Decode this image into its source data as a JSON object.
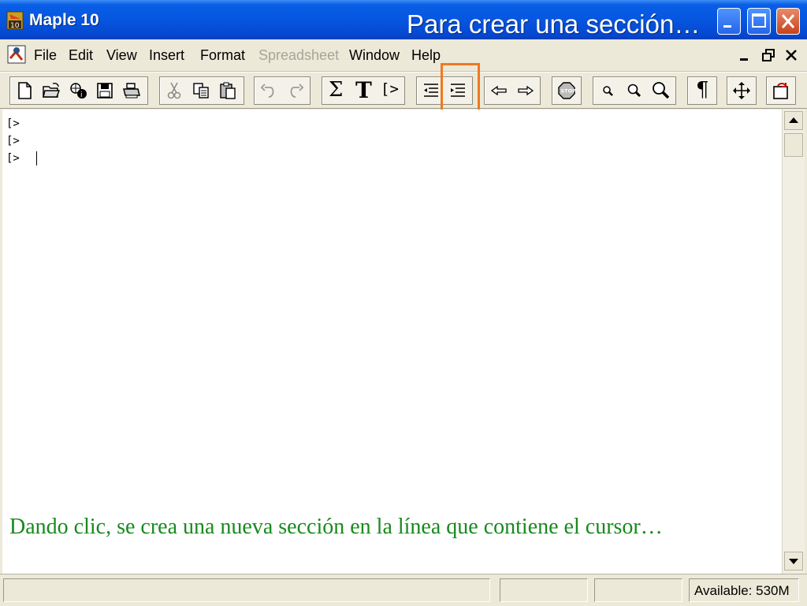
{
  "window": {
    "app_title": "Maple 10",
    "slide_title": "Para crear una sección…"
  },
  "menu": {
    "items": [
      "File",
      "Edit",
      "View",
      "Insert",
      "Format",
      "Spreadsheet",
      "Window",
      "Help"
    ],
    "disabled": [
      "Spreadsheet"
    ]
  },
  "toolbar": {
    "sum_glyph": "Σ",
    "text_glyph": "T",
    "prompt_glyph": "[>",
    "paragraph_glyph": "¶",
    "stop_label": "STOP"
  },
  "worksheet": {
    "prompts": [
      "[>",
      "[>",
      "[>"
    ]
  },
  "caption": {
    "text": "Dando clic, se crea una nueva sección en la línea que contiene el cursor…",
    "color": "#178a1c"
  },
  "status": {
    "memory": "Available: 530M"
  },
  "colors": {
    "title_bar": "#0656e0",
    "highlight": "#f07820"
  }
}
